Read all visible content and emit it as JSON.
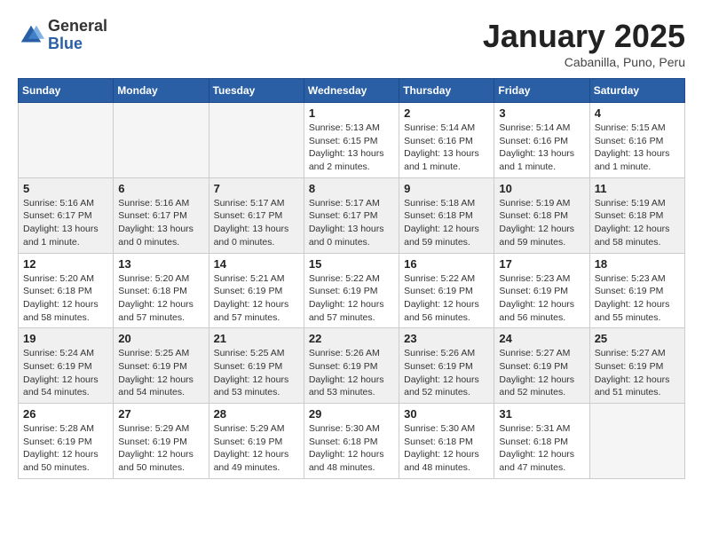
{
  "header": {
    "logo": {
      "general": "General",
      "blue": "Blue"
    },
    "title": "January 2025",
    "subtitle": "Cabanilla, Puno, Peru"
  },
  "weekdays": [
    "Sunday",
    "Monday",
    "Tuesday",
    "Wednesday",
    "Thursday",
    "Friday",
    "Saturday"
  ],
  "weeks": [
    [
      {
        "day": "",
        "info": ""
      },
      {
        "day": "",
        "info": ""
      },
      {
        "day": "",
        "info": ""
      },
      {
        "day": "1",
        "info": "Sunrise: 5:13 AM\nSunset: 6:15 PM\nDaylight: 13 hours\nand 2 minutes."
      },
      {
        "day": "2",
        "info": "Sunrise: 5:14 AM\nSunset: 6:16 PM\nDaylight: 13 hours\nand 1 minute."
      },
      {
        "day": "3",
        "info": "Sunrise: 5:14 AM\nSunset: 6:16 PM\nDaylight: 13 hours\nand 1 minute."
      },
      {
        "day": "4",
        "info": "Sunrise: 5:15 AM\nSunset: 6:16 PM\nDaylight: 13 hours\nand 1 minute."
      }
    ],
    [
      {
        "day": "5",
        "info": "Sunrise: 5:16 AM\nSunset: 6:17 PM\nDaylight: 13 hours\nand 1 minute."
      },
      {
        "day": "6",
        "info": "Sunrise: 5:16 AM\nSunset: 6:17 PM\nDaylight: 13 hours\nand 0 minutes."
      },
      {
        "day": "7",
        "info": "Sunrise: 5:17 AM\nSunset: 6:17 PM\nDaylight: 13 hours\nand 0 minutes."
      },
      {
        "day": "8",
        "info": "Sunrise: 5:17 AM\nSunset: 6:17 PM\nDaylight: 13 hours\nand 0 minutes."
      },
      {
        "day": "9",
        "info": "Sunrise: 5:18 AM\nSunset: 6:18 PM\nDaylight: 12 hours\nand 59 minutes."
      },
      {
        "day": "10",
        "info": "Sunrise: 5:19 AM\nSunset: 6:18 PM\nDaylight: 12 hours\nand 59 minutes."
      },
      {
        "day": "11",
        "info": "Sunrise: 5:19 AM\nSunset: 6:18 PM\nDaylight: 12 hours\nand 58 minutes."
      }
    ],
    [
      {
        "day": "12",
        "info": "Sunrise: 5:20 AM\nSunset: 6:18 PM\nDaylight: 12 hours\nand 58 minutes."
      },
      {
        "day": "13",
        "info": "Sunrise: 5:20 AM\nSunset: 6:18 PM\nDaylight: 12 hours\nand 57 minutes."
      },
      {
        "day": "14",
        "info": "Sunrise: 5:21 AM\nSunset: 6:19 PM\nDaylight: 12 hours\nand 57 minutes."
      },
      {
        "day": "15",
        "info": "Sunrise: 5:22 AM\nSunset: 6:19 PM\nDaylight: 12 hours\nand 57 minutes."
      },
      {
        "day": "16",
        "info": "Sunrise: 5:22 AM\nSunset: 6:19 PM\nDaylight: 12 hours\nand 56 minutes."
      },
      {
        "day": "17",
        "info": "Sunrise: 5:23 AM\nSunset: 6:19 PM\nDaylight: 12 hours\nand 56 minutes."
      },
      {
        "day": "18",
        "info": "Sunrise: 5:23 AM\nSunset: 6:19 PM\nDaylight: 12 hours\nand 55 minutes."
      }
    ],
    [
      {
        "day": "19",
        "info": "Sunrise: 5:24 AM\nSunset: 6:19 PM\nDaylight: 12 hours\nand 54 minutes."
      },
      {
        "day": "20",
        "info": "Sunrise: 5:25 AM\nSunset: 6:19 PM\nDaylight: 12 hours\nand 54 minutes."
      },
      {
        "day": "21",
        "info": "Sunrise: 5:25 AM\nSunset: 6:19 PM\nDaylight: 12 hours\nand 53 minutes."
      },
      {
        "day": "22",
        "info": "Sunrise: 5:26 AM\nSunset: 6:19 PM\nDaylight: 12 hours\nand 53 minutes."
      },
      {
        "day": "23",
        "info": "Sunrise: 5:26 AM\nSunset: 6:19 PM\nDaylight: 12 hours\nand 52 minutes."
      },
      {
        "day": "24",
        "info": "Sunrise: 5:27 AM\nSunset: 6:19 PM\nDaylight: 12 hours\nand 52 minutes."
      },
      {
        "day": "25",
        "info": "Sunrise: 5:27 AM\nSunset: 6:19 PM\nDaylight: 12 hours\nand 51 minutes."
      }
    ],
    [
      {
        "day": "26",
        "info": "Sunrise: 5:28 AM\nSunset: 6:19 PM\nDaylight: 12 hours\nand 50 minutes."
      },
      {
        "day": "27",
        "info": "Sunrise: 5:29 AM\nSunset: 6:19 PM\nDaylight: 12 hours\nand 50 minutes."
      },
      {
        "day": "28",
        "info": "Sunrise: 5:29 AM\nSunset: 6:19 PM\nDaylight: 12 hours\nand 49 minutes."
      },
      {
        "day": "29",
        "info": "Sunrise: 5:30 AM\nSunset: 6:18 PM\nDaylight: 12 hours\nand 48 minutes."
      },
      {
        "day": "30",
        "info": "Sunrise: 5:30 AM\nSunset: 6:18 PM\nDaylight: 12 hours\nand 48 minutes."
      },
      {
        "day": "31",
        "info": "Sunrise: 5:31 AM\nSunset: 6:18 PM\nDaylight: 12 hours\nand 47 minutes."
      },
      {
        "day": "",
        "info": ""
      }
    ]
  ]
}
